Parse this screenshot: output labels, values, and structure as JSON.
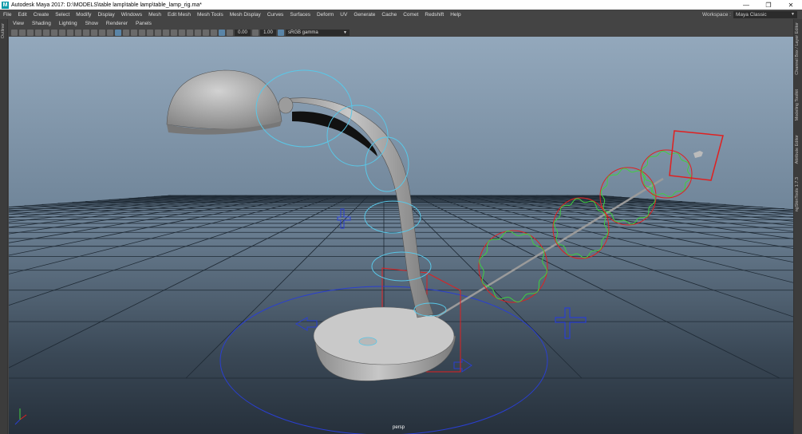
{
  "titlebar": {
    "app_icon": "maya-logo-icon",
    "title": "Autodesk Maya 2017: D:\\MODELS\\table lamp\\table lamp\\table_lamp_rig.ma*",
    "minimize": "—",
    "restore": "❐",
    "close": "✕"
  },
  "menubar": {
    "items": [
      "File",
      "Edit",
      "Create",
      "Select",
      "Modify",
      "Display",
      "Windows",
      "Mesh",
      "Edit Mesh",
      "Mesh Tools",
      "Mesh Display",
      "Curves",
      "Surfaces",
      "Deform",
      "UV",
      "Generate",
      "Cache",
      "Comet",
      "Redshift",
      "Help"
    ],
    "workspace_label": "Workspace :",
    "workspace_value": "Maya Classic"
  },
  "left_strip": {
    "label": "Outliner"
  },
  "right_strip": {
    "tabs": [
      "Channel Box / Layer Editor",
      "Modeling Toolkit",
      "Attribute Editor",
      "ngSkinTools 1.7.3"
    ]
  },
  "panel_menu": {
    "items": [
      "View",
      "Shading",
      "Lighting",
      "Show",
      "Renderer",
      "Panels"
    ]
  },
  "panel_toolbar": {
    "exposure": "0.00",
    "gamma": "1.00",
    "color_space": "sRGB gamma"
  },
  "viewport": {
    "camera_label": "persp",
    "colors": {
      "grid": "#1f2a35",
      "mesh": "#a9a9a9",
      "ctrl_blue": "#59c8e8",
      "ctrl_red": "#e02020",
      "ctrl_green": "#40d040",
      "ctrl_dark_blue": "#2a3fd0"
    }
  }
}
